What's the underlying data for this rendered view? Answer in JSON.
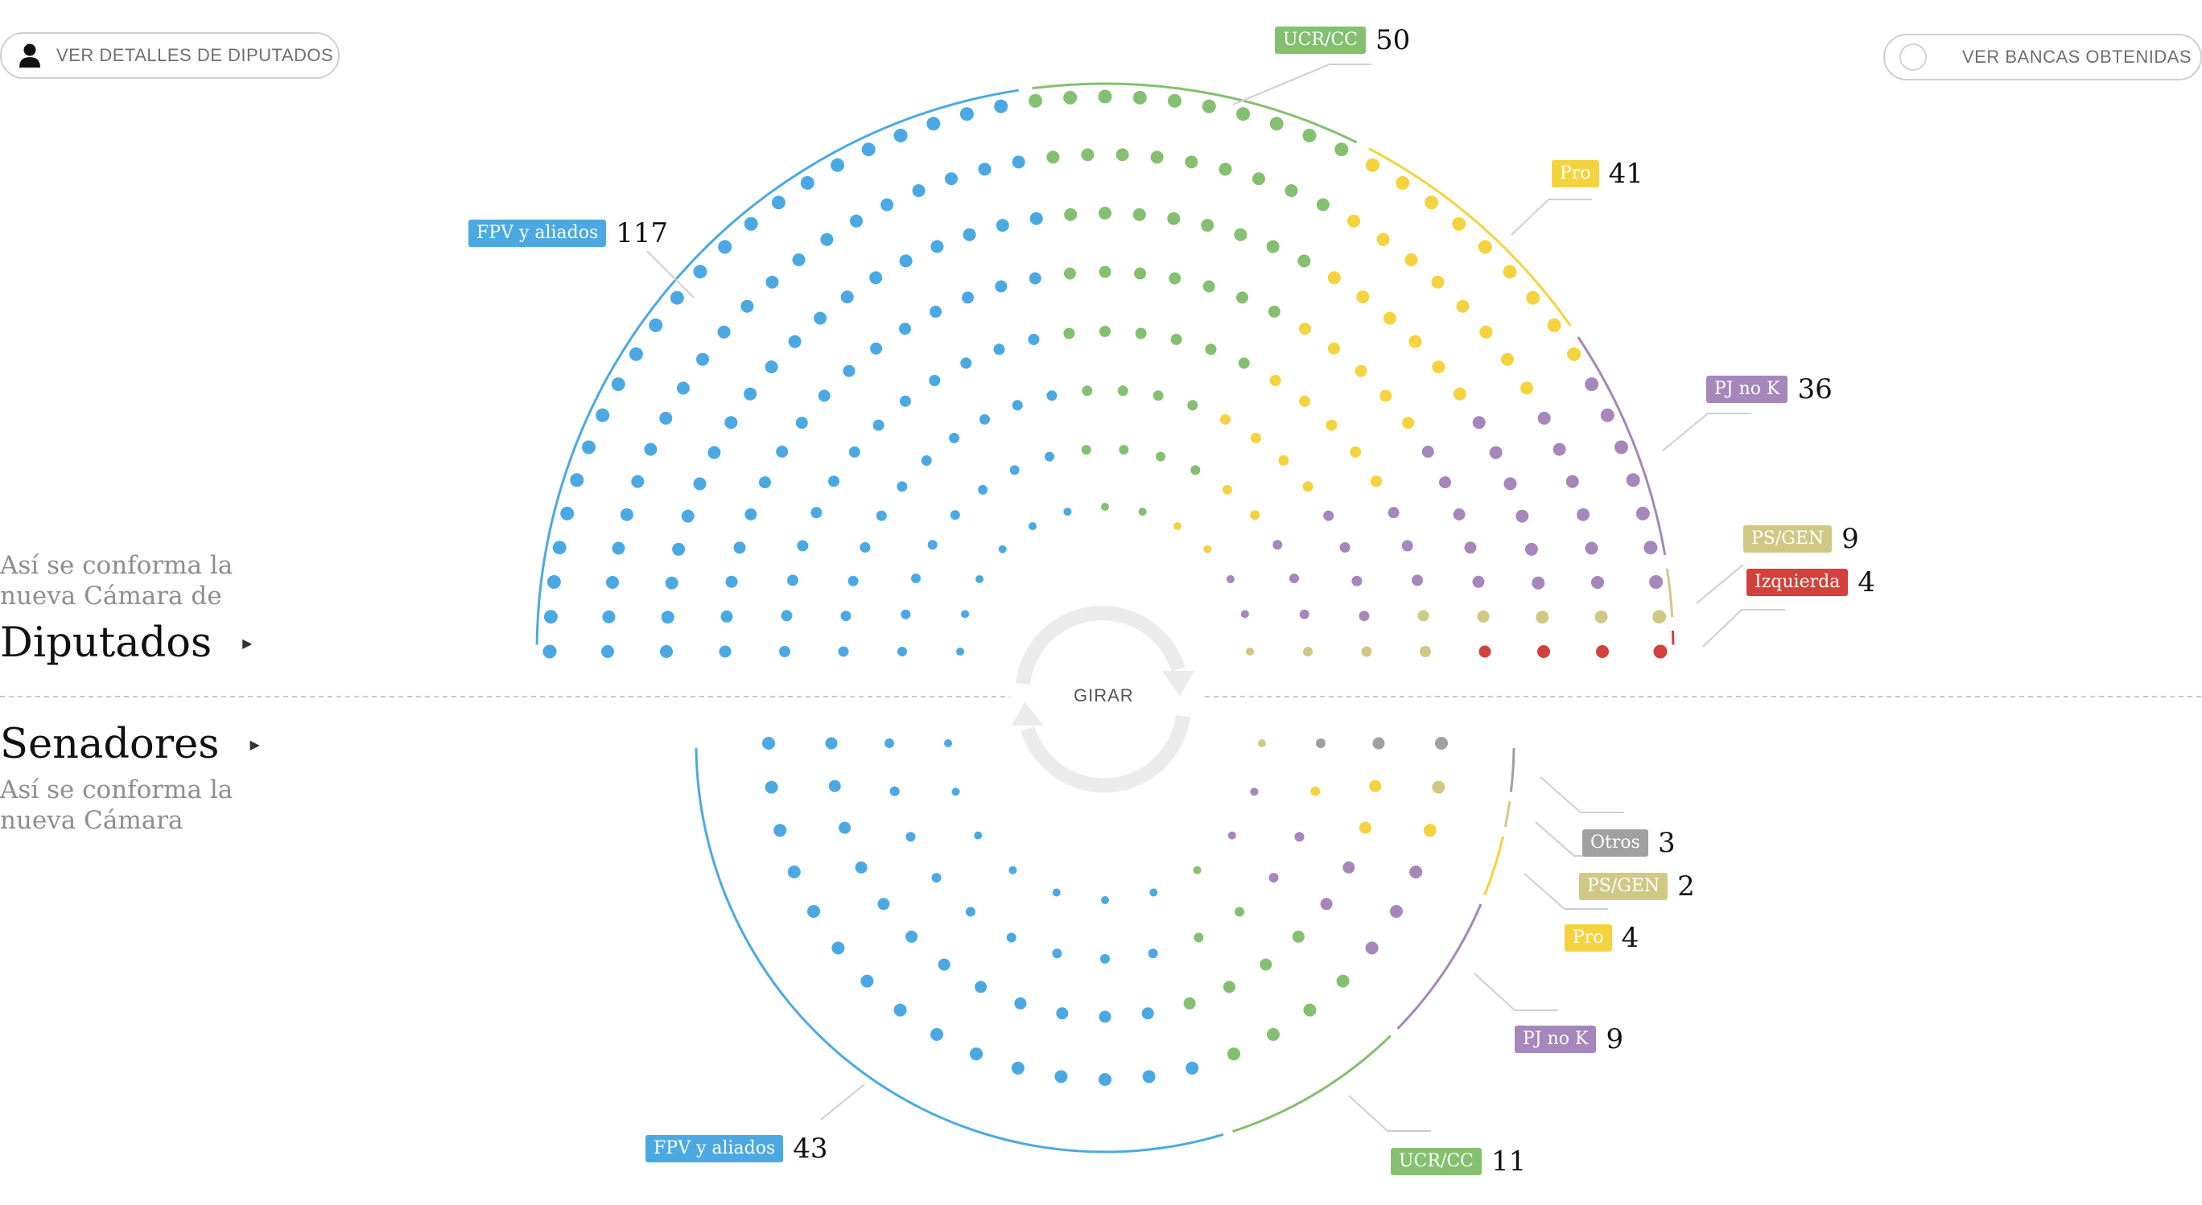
{
  "controls": {
    "details_button": "VER DETALLES DE DIPUTADOS",
    "seats_button": "VER BANCAS OBTENIDAS",
    "rotate_label": "GIRAR"
  },
  "diputados": {
    "intro": "Así se conforma la nueva Cámara de",
    "title": "Diputados"
  },
  "senadores": {
    "title": "Senadores",
    "intro": "Así se conforma la nueva Cámara"
  },
  "chart_data": [
    {
      "type": "parliament",
      "chamber": "Diputados",
      "total_seats": 257,
      "series": [
        {
          "name": "FPV y aliados",
          "value": 117,
          "color": "#4aa9e3"
        },
        {
          "name": "UCR/CC",
          "value": 50,
          "color": "#84c06f"
        },
        {
          "name": "Pro",
          "value": 41,
          "color": "#f5d33e"
        },
        {
          "name": "PJ no K",
          "value": 36,
          "color": "#a587bb"
        },
        {
          "name": "PS/GEN",
          "value": 9,
          "color": "#cfc985"
        },
        {
          "name": "Izquierda",
          "value": 4,
          "color": "#d2413c"
        }
      ]
    },
    {
      "type": "parliament",
      "chamber": "Senadores",
      "total_seats": 72,
      "series": [
        {
          "name": "FPV y aliados",
          "value": 43,
          "color": "#4aa9e3"
        },
        {
          "name": "UCR/CC",
          "value": 11,
          "color": "#84c06f"
        },
        {
          "name": "PJ no K",
          "value": 9,
          "color": "#a587bb"
        },
        {
          "name": "Pro",
          "value": 4,
          "color": "#f5d33e"
        },
        {
          "name": "PS/GEN",
          "value": 2,
          "color": "#cfc985"
        },
        {
          "name": "Otros",
          "value": 3,
          "color": "#a0a0a0"
        }
      ]
    }
  ]
}
